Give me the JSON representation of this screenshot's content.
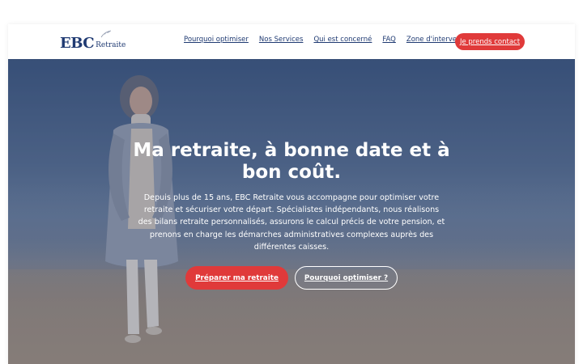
{
  "header": {
    "logo": {
      "brand": "EBC",
      "subtitle": "Retraite",
      "icon": "leaf-icon"
    },
    "nav": [
      {
        "label": "Pourquoi optimiser"
      },
      {
        "label": "Nos Services"
      },
      {
        "label": "Qui est concerné"
      },
      {
        "label": "FAQ"
      },
      {
        "label": "Zone d'intervention"
      }
    ],
    "contact_label": "Je prends contact"
  },
  "hero": {
    "title_line1": "Ma retraite, à bonne date et à",
    "title_line2": "bon coût.",
    "description": "Depuis plus de 15 ans, EBC Retraite vous accompagne pour optimiser votre retraite et sécuriser votre départ. Spécialistes indépendants, nous réalisons des bilans retraite personnalisés, assurons le calcul précis de votre pension, et prenons en charge les démarches administratives complexes auprès des différentes caisses.",
    "primary_cta": "Préparer ma retraite",
    "secondary_cta": "Pourquoi optimiser ?"
  },
  "colors": {
    "brand_blue": "#1f3a72",
    "accent_red": "#e03a3a",
    "text_white": "#ffffff"
  }
}
